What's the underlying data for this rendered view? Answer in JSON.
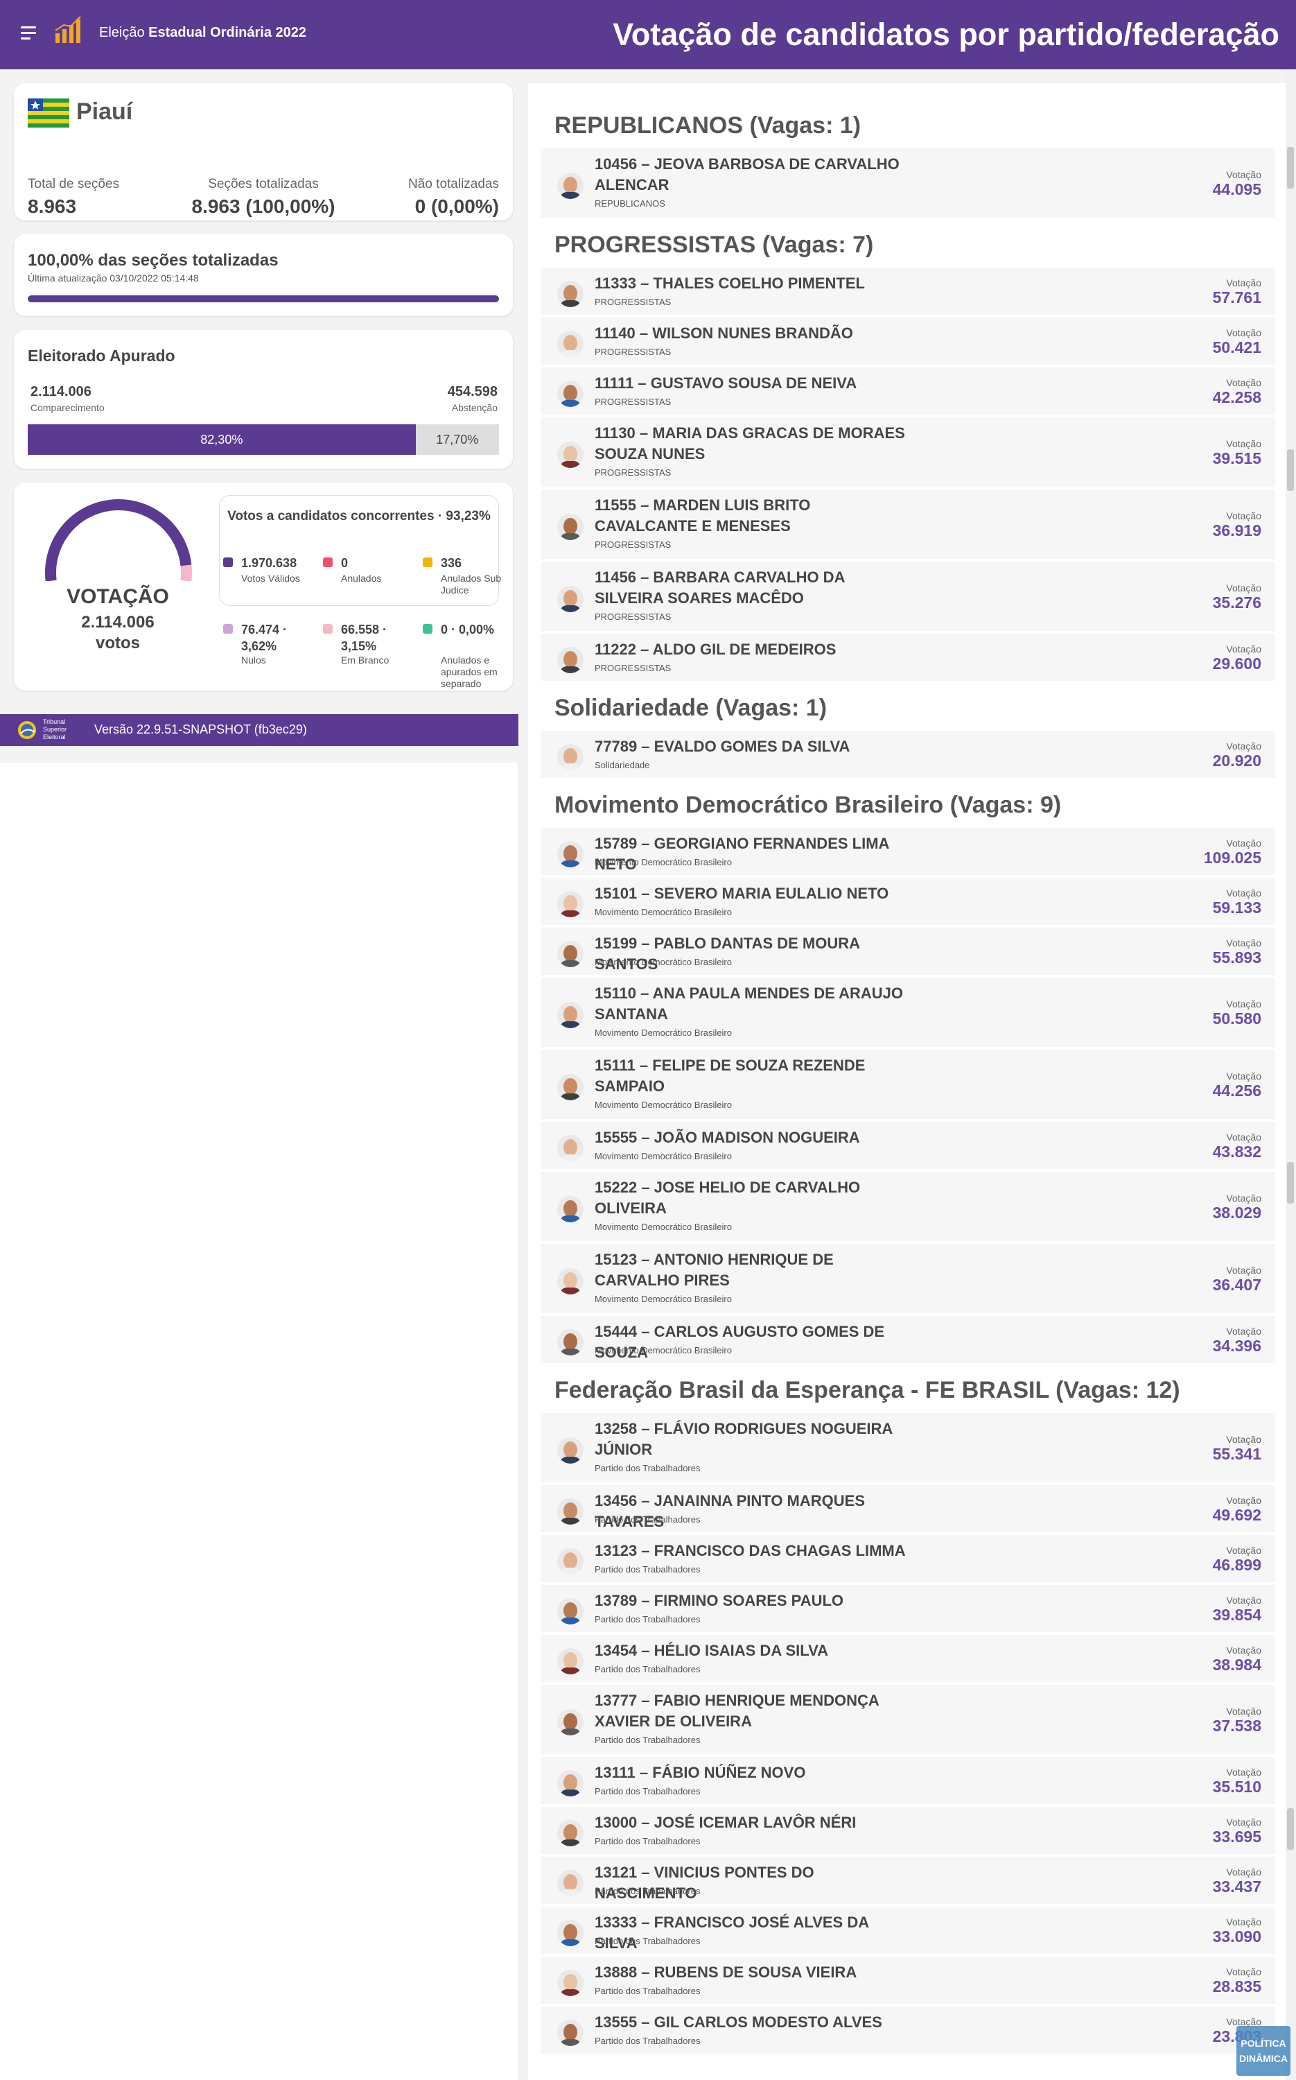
{
  "header": {
    "election_prefix": "Eleição ",
    "election_name": "Estadual Ordinária 2022",
    "title": "Votação de candidatos por partido/federação"
  },
  "state": {
    "name": "Piauí",
    "sections_total_label": "Total de seções",
    "sections_total": "8.963",
    "sections_counted_label": "Seções totalizadas",
    "sections_counted": "8.963 (100,00%)",
    "not_counted_label": "Não totalizadas",
    "not_counted": "0 (0,00%)"
  },
  "progress": {
    "title": "100,00% das seções totalizadas",
    "updated": "Última atualização 03/10/2022 05:14:48",
    "percent": 100
  },
  "electorate": {
    "title": "Eleitorado Apurado",
    "turnout": "2.114.006",
    "turnout_label": "Comparecimento",
    "abstention": "454.598",
    "abstention_label": "Abstenção",
    "turnout_pct_label": "82,30%",
    "abstention_pct_label": "17,70%",
    "turnout_pct": 82.3
  },
  "votes": {
    "title": "VOTAÇÃO",
    "total": "2.114.006",
    "unit": "votos",
    "gauge_fraction": 0.9323,
    "candidates_title": "Votos a candidatos concorrentes · 93,23%",
    "legend": [
      {
        "value": "1.970.638",
        "label": "Votos Válidos",
        "color": "#5b3a91"
      },
      {
        "value": "0",
        "label": "Anulados",
        "color": "#f0506e"
      },
      {
        "value": "336",
        "label": "Anulados Sub Judice",
        "color": "#f4b400"
      },
      {
        "value": "76.474 · 3,62%",
        "label": "Nulos",
        "color": "#c9a6d9"
      },
      {
        "value": "66.558 · 3,15%",
        "label": "Em Branco",
        "color": "#f6b7c6"
      },
      {
        "value": "0 · 0,00%",
        "label": "Anulados e apurados em separado",
        "color": "#3cc29a"
      }
    ]
  },
  "footer": {
    "tse_line1": "Tribunal",
    "tse_line2": "Superior",
    "tse_line3": "Eleitoral",
    "version": "Versão 22.9.51-SNAPSHOT (fb3ec29)"
  },
  "vote_label": "Votação",
  "parties": [
    {
      "title": "REPUBLICANOS (Vagas: 1)",
      "candidates": [
        {
          "name": "10456 – JEOVA BARBOSA DE CARVALHO ALENCAR",
          "party": "REPUBLICANOS",
          "votes": "44.095"
        }
      ]
    },
    {
      "title": "PROGRESSISTAS (Vagas: 7)",
      "candidates": [
        {
          "name": "11333 – THALES COELHO PIMENTEL",
          "party": "PROGRESSISTAS",
          "votes": "57.761"
        },
        {
          "name": "11140 – WILSON NUNES BRANDÃO",
          "party": "PROGRESSISTAS",
          "votes": "50.421"
        },
        {
          "name": "11111 – GUSTAVO SOUSA DE NEIVA",
          "party": "PROGRESSISTAS",
          "votes": "42.258"
        },
        {
          "name": "11130 – MARIA DAS GRACAS DE MORAES SOUZA NUNES",
          "party": "PROGRESSISTAS",
          "votes": "39.515"
        },
        {
          "name": "11555 – MARDEN LUIS BRITO CAVALCANTE E MENESES",
          "party": "PROGRESSISTAS",
          "votes": "36.919"
        },
        {
          "name": "11456 – BARBARA CARVALHO DA SILVEIRA SOARES MACÊDO",
          "party": "PROGRESSISTAS",
          "votes": "35.276"
        },
        {
          "name": "11222 – ALDO GIL DE MEDEIROS",
          "party": "PROGRESSISTAS",
          "votes": "29.600"
        }
      ]
    },
    {
      "title": "Solidariedade (Vagas: 1)",
      "candidates": [
        {
          "name": "77789 – EVALDO GOMES DA SILVA",
          "party": "Solidariedade",
          "votes": "20.920"
        }
      ]
    },
    {
      "title": "Movimento Democrático Brasileiro (Vagas: 9)",
      "candidates": [
        {
          "name": "15789 – GEORGIANO FERNANDES LIMA NETO",
          "party": "Movimento Democrático Brasileiro",
          "votes": "109.025"
        },
        {
          "name": "15101 – SEVERO MARIA EULALIO NETO",
          "party": "Movimento Democrático Brasileiro",
          "votes": "59.133"
        },
        {
          "name": "15199 – PABLO DANTAS DE MOURA SANTOS",
          "party": "Movimento Democrático Brasileiro",
          "votes": "55.893"
        },
        {
          "name": "15110 – ANA PAULA MENDES DE ARAUJO SANTANA",
          "party": "Movimento Democrático Brasileiro",
          "votes": "50.580"
        },
        {
          "name": "15111 – FELIPE DE SOUZA REZENDE SAMPAIO",
          "party": "Movimento Democrático Brasileiro",
          "votes": "44.256"
        },
        {
          "name": "15555 – JOÃO MADISON NOGUEIRA",
          "party": "Movimento Democrático Brasileiro",
          "votes": "43.832"
        },
        {
          "name": "15222 – JOSE HELIO DE CARVALHO OLIVEIRA",
          "party": "Movimento Democrático Brasileiro",
          "votes": "38.029"
        },
        {
          "name": "15123 – ANTONIO HENRIQUE DE CARVALHO PIRES",
          "party": "Movimento Democrático Brasileiro",
          "votes": "36.407"
        },
        {
          "name": "15444 – CARLOS AUGUSTO GOMES DE SOUZA",
          "party": "Movimento Democrático Brasileiro",
          "votes": "34.396"
        }
      ]
    },
    {
      "title": "Federação Brasil da Esperança - FE BRASIL (Vagas: 12)",
      "candidates": [
        {
          "name": "13258 – FLÁVIO RODRIGUES NOGUEIRA JÚNIOR",
          "party": "Partido dos Trabalhadores",
          "votes": "55.341"
        },
        {
          "name": "13456 – JANAINNA PINTO MARQUES TAVARES",
          "party": "Partido dos Trabalhadores",
          "votes": "49.692"
        },
        {
          "name": "13123 – FRANCISCO DAS CHAGAS LIMMA",
          "party": "Partido dos Trabalhadores",
          "votes": "46.899"
        },
        {
          "name": "13789 – FIRMINO SOARES PAULO",
          "party": "Partido dos Trabalhadores",
          "votes": "39.854"
        },
        {
          "name": "13454 – HÉLIO ISAIAS DA SILVA",
          "party": "Partido dos Trabalhadores",
          "votes": "38.984"
        },
        {
          "name": "13777 – FABIO HENRIQUE MENDONÇA XAVIER DE OLIVEIRA",
          "party": "Partido dos Trabalhadores",
          "votes": "37.538"
        },
        {
          "name": "13111 – FÁBIO NÚÑEZ NOVO",
          "party": "Partido dos Trabalhadores",
          "votes": "35.510"
        },
        {
          "name": "13000 – JOSÉ ICEMAR LAVÔR NÉRI",
          "party": "Partido dos Trabalhadores",
          "votes": "33.695"
        },
        {
          "name": "13121 – VINICIUS PONTES DO NASCIMENTO",
          "party": "Partido dos Trabalhadores",
          "votes": "33.437"
        },
        {
          "name": "13333 – FRANCISCO JOSÉ ALVES DA SILVA",
          "party": "Partido dos Trabalhadores",
          "votes": "33.090"
        },
        {
          "name": "13888 – RUBENS DE SOUSA VIEIRA",
          "party": "Partido dos Trabalhadores",
          "votes": "28.835"
        },
        {
          "name": "13555 – GIL CARLOS MODESTO ALVES",
          "party": "Partido dos Trabalhadores",
          "votes": "23.803"
        }
      ]
    }
  ],
  "watermark": {
    "line1": "POLÍTICA",
    "line2": "DINÂMICA"
  }
}
